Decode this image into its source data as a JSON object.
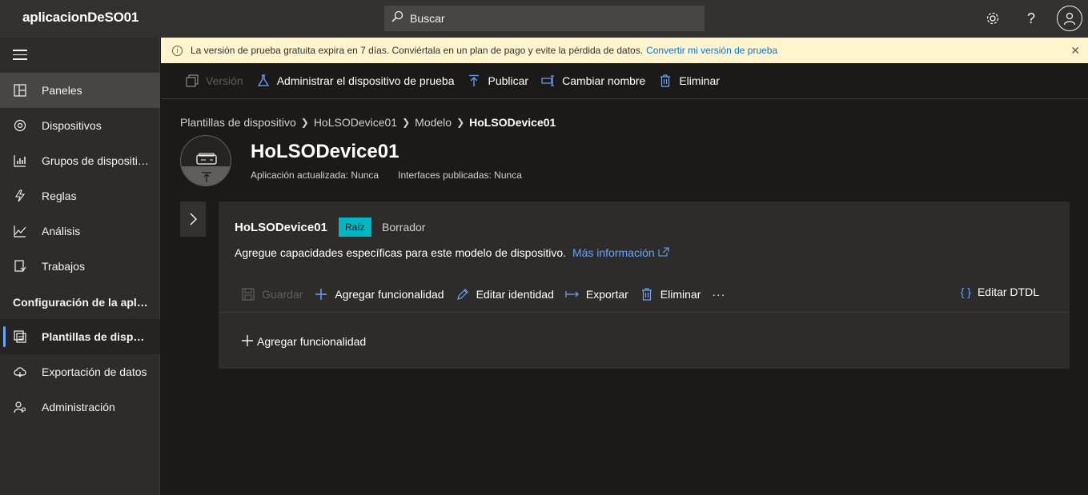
{
  "header": {
    "app_title": "aplicacionDeSO01",
    "search_placeholder": "Buscar"
  },
  "sidebar": {
    "items": [
      {
        "label": "Paneles",
        "icon": "dashboard-icon"
      },
      {
        "label": "Dispositivos",
        "icon": "devices-icon"
      },
      {
        "label": "Grupos de dispositivos",
        "icon": "device-groups-icon"
      },
      {
        "label": "Reglas",
        "icon": "rules-icon"
      },
      {
        "label": "Análisis",
        "icon": "analytics-icon"
      },
      {
        "label": "Trabajos",
        "icon": "jobs-icon"
      }
    ],
    "section_label": "Configuración de la aplicación",
    "config_items": [
      {
        "label": "Plantillas de dispositivo",
        "icon": "device-templates-icon"
      },
      {
        "label": "Exportación de datos",
        "icon": "data-export-icon"
      },
      {
        "label": "Administración",
        "icon": "administration-icon"
      }
    ]
  },
  "banner": {
    "text": "La versión de prueba gratuita expira en 7 días. Conviértala en un plan de pago y evite la pérdida de datos.",
    "link": "Convertir mi versión de prueba"
  },
  "command_bar": {
    "version": "Versión",
    "manage_test": "Administrar el dispositivo de prueba",
    "publish": "Publicar",
    "rename": "Cambiar nombre",
    "delete": "Eliminar"
  },
  "breadcrumb": {
    "items": [
      "Plantillas de dispositivo",
      "HoLSODevice01",
      "Modelo"
    ],
    "current": "HoLSODevice01"
  },
  "page": {
    "title": "HoLSODevice01",
    "app_updated": "Aplicación actualizada: Nunca",
    "interfaces_published": "Interfaces publicadas: Nunca"
  },
  "card": {
    "title": "HoLSODevice01",
    "badge": "Raíz",
    "status": "Borrador",
    "description": "Agregue capacidades específicas para este modelo de dispositivo.",
    "more_info": "Más información",
    "save": "Guardar",
    "add_capability": "Agregar funcionalidad",
    "edit_identity": "Editar identidad",
    "export": "Exportar",
    "delete": "Eliminar",
    "more": "···",
    "edit_dtdl": "Editar DTDL",
    "add_capability_link": "Agregar funcionalidad"
  },
  "colors": {
    "accent": "#6ca4f7",
    "badge": "#00b7c3",
    "banner": "#fff4ce"
  }
}
